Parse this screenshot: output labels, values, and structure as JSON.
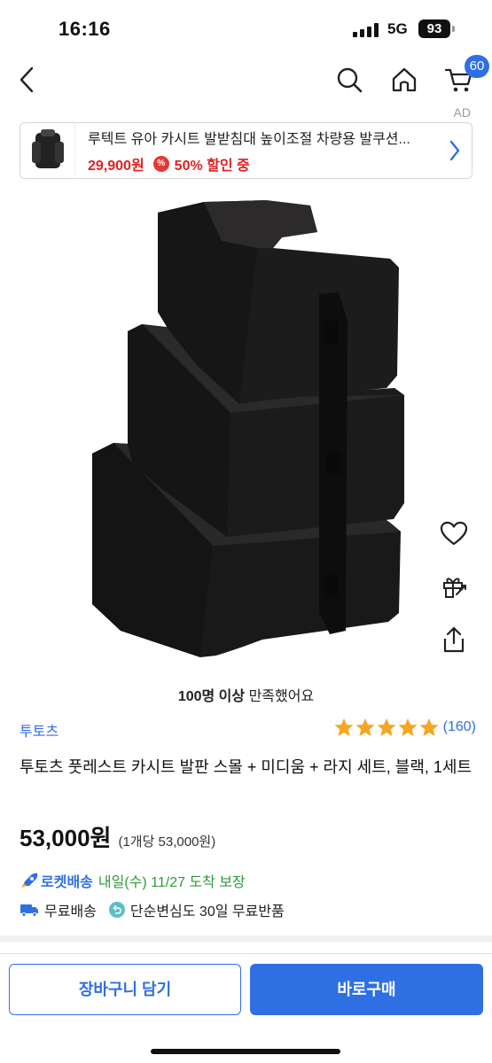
{
  "status_bar": {
    "time": "16:16",
    "network": "5G",
    "battery": "93"
  },
  "nav": {
    "back_icon": "chevron-left-icon",
    "search_icon": "search-icon",
    "home_icon": "home-icon",
    "cart_icon": "cart-icon",
    "cart_count": "60"
  },
  "ad": {
    "label": "AD",
    "title": "루텍트 유아 카시트 발받침대 높이조절 차량용 발쿠션...",
    "price": "29,900원",
    "discount": "50% 할인 중"
  },
  "product": {
    "satisfaction_bold": "100명 이상",
    "satisfaction_rest": " 만족했어요",
    "brand": "투토츠",
    "rating": 5,
    "review_count": "(160)",
    "title": "투토츠 풋레스트 카시트 발판 스몰 + 미디움 + 라지 세트, 블랙, 1세트",
    "price": "53,000원",
    "unit_price": "(1개당 53,000원)"
  },
  "delivery": {
    "rocket_label": "로켓배송",
    "rocket_date": "내일(수) 11/27 도착 보장",
    "free_shipping": "무료배송",
    "free_return": "단순변심도 30일 무료반품"
  },
  "buttons": {
    "cart": "장바구니 담기",
    "buy": "바로구매"
  },
  "colors": {
    "accent": "#2f6fe4",
    "discount_red": "#e02020",
    "delivery_green": "#2f9a3c",
    "star": "#f5a623"
  }
}
